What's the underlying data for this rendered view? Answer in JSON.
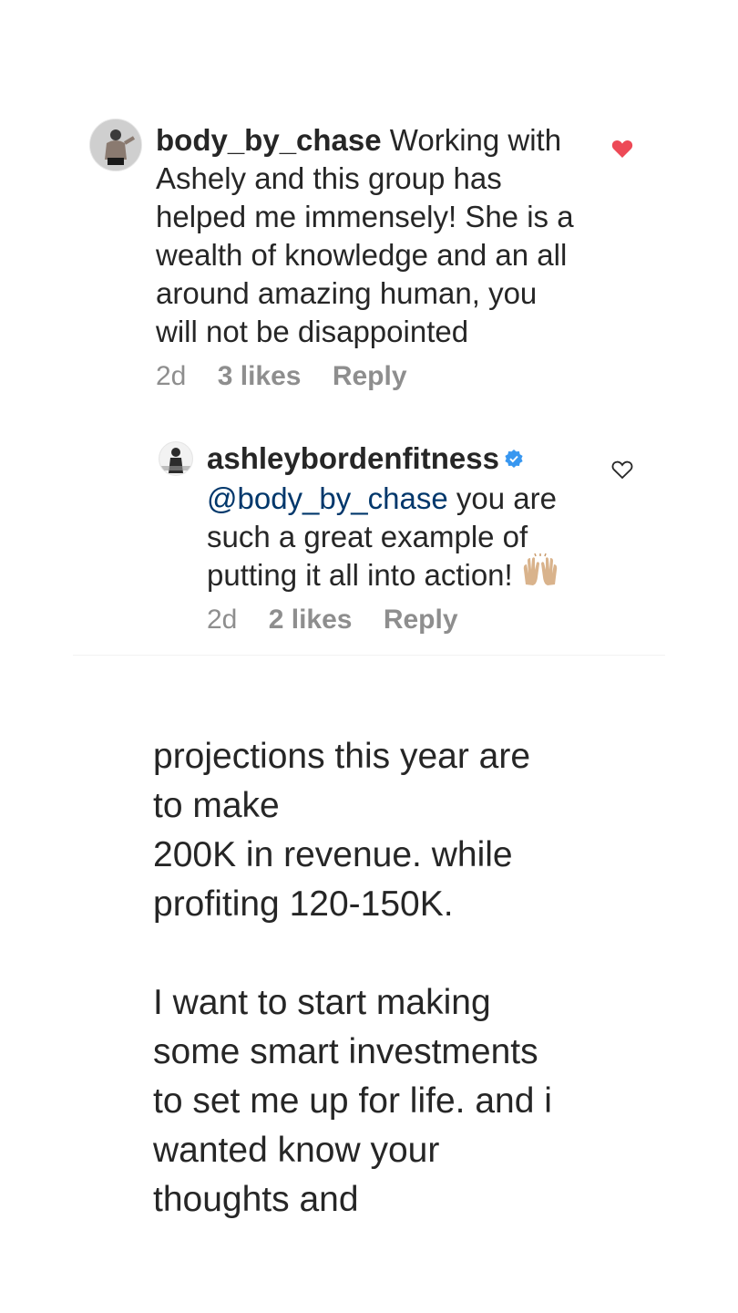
{
  "comments": [
    {
      "username": "body_by_chase",
      "text": "Working with Ashely and this group has helped me immensely! She is a wealth of knowledge and an all around amazing human, you will not be disappointed",
      "time": "2d",
      "likes": "3 likes",
      "reply": "Reply",
      "liked": true,
      "avatar_icon": "person-photo-avatar"
    },
    {
      "username": "ashleybordenfitness",
      "verified": true,
      "mention": "@body_by_chase",
      "text": "you are such a great example of putting it all into action!",
      "emoji": "🙌🏼",
      "time": "2d",
      "likes": "2 likes",
      "reply": "Reply",
      "liked": false,
      "avatar_icon": "magazine-cover-avatar"
    }
  ],
  "note": {
    "line1": "projections this year are",
    "line2": "to make",
    "line3": "200K in revenue. while",
    "line4": "profiting 120-150K.",
    "line5": "I want to start making",
    "line6": "some smart investments",
    "line7": "to set me up for life. and i",
    "line8": "wanted know your",
    "line9": "thoughts and"
  },
  "colors": {
    "text": "#262626",
    "secondary": "#8e8e8e",
    "mention": "#00376b",
    "liked_heart": "#ed4956",
    "verified_badge": "#3897f0"
  }
}
